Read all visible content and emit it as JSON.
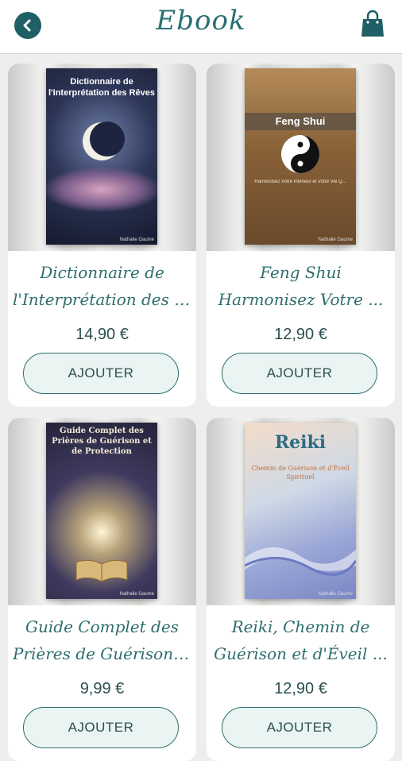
{
  "header": {
    "title": "Ebook",
    "back_icon": "chevron-left-icon",
    "cart_icon": "shopping-bag-icon"
  },
  "colors": {
    "accent": "#1f5f66",
    "button_bg": "#e9f4f3",
    "page_bg": "#eeeeef"
  },
  "products": [
    {
      "cover_title": "Dictionnaire de l'Interprétation des Rêves",
      "cover_author": "Nathalie Gaume",
      "name_line1": "Dictionnaire de",
      "name_line2": "l'Interprétation des Rê...",
      "price": "14,90 €",
      "button": "AJOUTER"
    },
    {
      "cover_title": "Feng Shui",
      "cover_subtitle": "Harmonisez Votre Intérieur et Votre Vie Q...",
      "cover_author": "Nathalie Gaume",
      "name_line1": "Feng Shui",
      "name_line2": "Harmonisez Votre ...",
      "price": "12,90 €",
      "button": "AJOUTER"
    },
    {
      "cover_title": "Guide Complet des Prières de Guérison et de Protection",
      "cover_author": "Nathalie Gaume",
      "name_line1": "Guide Complet des",
      "name_line2": "Prières de Guérison et...",
      "price": "9,99 €",
      "button": "AJOUTER"
    },
    {
      "cover_title": "Reiki",
      "cover_subtitle": "Chemin de Guérison et d'Éveil Spirituel",
      "cover_author": "Nathalie Gaume",
      "name_line1": "Reiki, Chemin de",
      "name_line2": "Guérison et d'Éveil ...",
      "price": "12,90 €",
      "button": "AJOUTER"
    }
  ]
}
